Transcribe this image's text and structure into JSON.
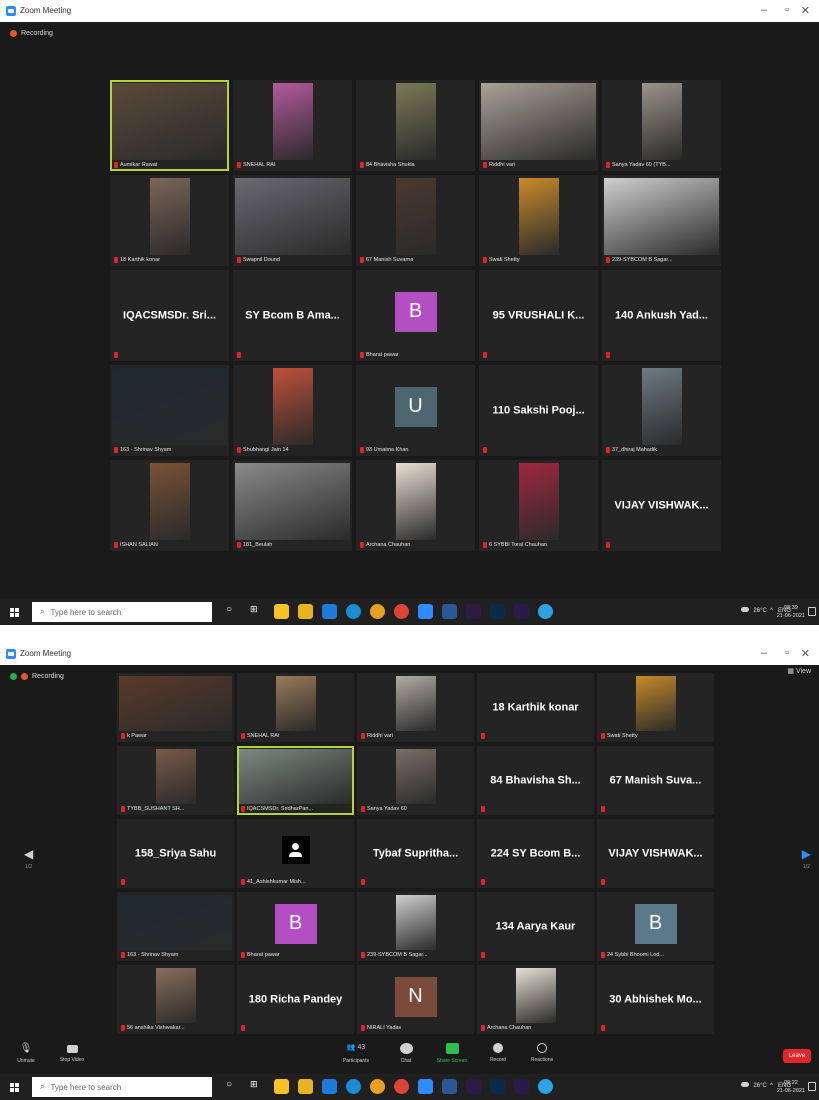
{
  "window": {
    "title": "Zoom Meeting",
    "recording_label": "Recording",
    "view_label": "View"
  },
  "grid1": {
    "tiles": [
      {
        "name": "Aumikar Rawat",
        "kind": "video",
        "bg": "#5a4a3a",
        "active": true
      },
      {
        "name": "SNEHAL RAI",
        "kind": "video",
        "bg": "#b45a9e"
      },
      {
        "name": "84 Bhavisha Shukla",
        "kind": "video",
        "bg": "#7a7a58"
      },
      {
        "name": "Riddhi vari",
        "kind": "video",
        "bg": "#a8a196"
      },
      {
        "name": "Sanya Yadav 60 (TYB...",
        "kind": "video",
        "bg": "#9a9389"
      },
      {
        "name": "18 Karthik konar",
        "kind": "video",
        "bg": "#7a6658"
      },
      {
        "name": "Swapnil Dound",
        "kind": "video",
        "bg": "#6a6a70"
      },
      {
        "name": "67 Manish Suvarna",
        "kind": "video",
        "bg": "#4a3a30"
      },
      {
        "name": "Swati Shetty",
        "kind": "video",
        "bg": "#c88a2a"
      },
      {
        "name": "239-SYBCOM B Sagar...",
        "kind": "video",
        "bg": "#cfcfcf"
      },
      {
        "name": "IQACSMSDr. Sri...",
        "kind": "name"
      },
      {
        "name": "SY Bcom B Ama...",
        "kind": "name"
      },
      {
        "name": "Bharat pawar",
        "kind": "letter",
        "letter": "B",
        "bg": "#b34fc2"
      },
      {
        "name": "95 VRUSHALI K...",
        "kind": "name"
      },
      {
        "name": "140 Ankush Yad...",
        "kind": "name"
      },
      {
        "name": "163 - Shrinav Shyam",
        "kind": "video",
        "bg": "#1e2a33"
      },
      {
        "name": "Shubhangi Jain 14",
        "kind": "video",
        "bg": "#c0503c"
      },
      {
        "name": "93 Umaima Khan",
        "kind": "letter",
        "letter": "U",
        "bg": "#4d6670"
      },
      {
        "name": "110 Sakshi Pooj...",
        "kind": "name"
      },
      {
        "name": "37_dhiraj Mahadik",
        "kind": "video",
        "bg": "#6e7a82"
      },
      {
        "name": "ISHAN SALIAN",
        "kind": "video",
        "bg": "#7a5236"
      },
      {
        "name": "181_Beulah",
        "kind": "video",
        "bg": "#8a8a8a"
      },
      {
        "name": "Archana Chauhan",
        "kind": "video",
        "bg": "#e8e0d4"
      },
      {
        "name": "6 SYBBI Toral Chauhan",
        "kind": "video",
        "bg": "#a02840"
      },
      {
        "name": "VIJAY VISHWAK...",
        "kind": "name"
      }
    ]
  },
  "grid2": {
    "tiles": [
      {
        "name": "k Pawar",
        "kind": "video",
        "bg": "#5a3a2a"
      },
      {
        "name": "SNEHAL RAI",
        "kind": "video",
        "bg": "#9a7a5a"
      },
      {
        "name": "Riddhi vari",
        "kind": "video",
        "bg": "#b0aca4"
      },
      {
        "name": "18 Karthik konar",
        "kind": "name"
      },
      {
        "name": "Swati Shetty",
        "kind": "video",
        "bg": "#c88a2a"
      },
      {
        "name": "TYBB_SUSHANT SH...",
        "kind": "video",
        "bg": "#7a5a48"
      },
      {
        "name": "IQACSMSDr. SridharPan...",
        "kind": "video",
        "bg": "#7a8a82",
        "active": true
      },
      {
        "name": "Sanya Yadav 60",
        "kind": "video",
        "bg": "#7a6e66"
      },
      {
        "name": "84 Bhavisha Sh...",
        "kind": "name"
      },
      {
        "name": "67 Manish Suva...",
        "kind": "name"
      },
      {
        "name": "158_Sriya Sahu",
        "kind": "name"
      },
      {
        "name": "41_Ashishkumar Mish...",
        "kind": "avatar"
      },
      {
        "name": "Tybaf Supritha...",
        "kind": "name"
      },
      {
        "name": "224 SY Bcom B...",
        "kind": "name"
      },
      {
        "name": "VIJAY VISHWAK...",
        "kind": "name"
      },
      {
        "name": "163 - Shrinav Shyam",
        "kind": "video",
        "bg": "#1e2a33"
      },
      {
        "name": "Bharat pawar",
        "kind": "letter",
        "letter": "B",
        "bg": "#b34fc2"
      },
      {
        "name": "239-SYBCOM B Sagar...",
        "kind": "video",
        "bg": "#cfcfcf"
      },
      {
        "name": "134 Aarya Kaur",
        "kind": "name"
      },
      {
        "name": "24 Sybbi Bhoomi Lod...",
        "kind": "letter",
        "letter": "B",
        "bg": "#5a7a8a"
      },
      {
        "name": "56 anshika Vishwakar...",
        "kind": "video",
        "bg": "#8a6e5a"
      },
      {
        "name": "180 Richa Pandey",
        "kind": "name"
      },
      {
        "name": "NIRALI Yadav",
        "kind": "letter",
        "letter": "N",
        "bg": "#7a4a3a"
      },
      {
        "name": "Archana Chauhan",
        "kind": "video",
        "bg": "#e8e0d4"
      },
      {
        "name": "30 Abhishek Mo...",
        "kind": "name"
      }
    ],
    "page_left": "1/2",
    "page_right": "1/2"
  },
  "controls": {
    "unmute": "Unmute",
    "stop_video": "Stop Video",
    "participants": "Participants",
    "participants_count": "43",
    "chat": "Chat",
    "share_screen": "Share Screen",
    "record": "Record",
    "reactions": "Reactions",
    "leave": "Leave"
  },
  "taskbar": {
    "search_placeholder": "Type here to search",
    "weather": "26°C",
    "lang": "ENG",
    "shot1_time": "08:39",
    "shot1_date": "21-06-2021",
    "shot2_time": "09:22",
    "shot2_date": "21-06-2021"
  },
  "colors": {
    "active_border": "#b5d334",
    "accent": "#2d8cff",
    "mic_muted": "#e02424",
    "leave": "#e02828"
  }
}
